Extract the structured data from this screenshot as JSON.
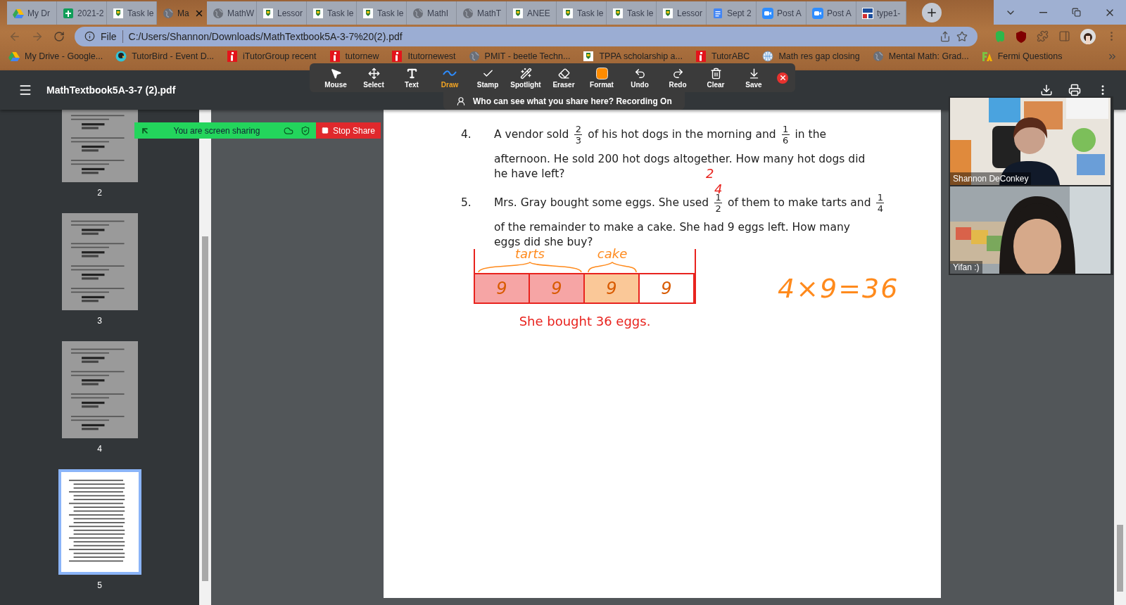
{
  "browser": {
    "tabs": [
      {
        "title": "My Dr",
        "kind": "drive",
        "selected": false
      },
      {
        "title": "2021-2",
        "kind": "sheets",
        "selected": false
      },
      {
        "title": "Task le",
        "kind": "crest",
        "selected": false
      },
      {
        "title": "Ma",
        "kind": "globe",
        "selected": true
      },
      {
        "title": "MathW",
        "kind": "globe",
        "selected": false
      },
      {
        "title": "Lessor",
        "kind": "crest",
        "selected": false
      },
      {
        "title": "Task le",
        "kind": "crest",
        "selected": false
      },
      {
        "title": "Task le",
        "kind": "crest",
        "selected": false
      },
      {
        "title": "MathI",
        "kind": "globe",
        "selected": false
      },
      {
        "title": "MathT",
        "kind": "globe",
        "selected": false
      },
      {
        "title": "ANEE",
        "kind": "crest",
        "selected": false
      },
      {
        "title": "Task le",
        "kind": "crest",
        "selected": false
      },
      {
        "title": "Task le",
        "kind": "crest",
        "selected": false
      },
      {
        "title": "Lessor",
        "kind": "crest",
        "selected": false
      },
      {
        "title": "Sept 2",
        "kind": "docs",
        "selected": false
      },
      {
        "title": "Post A",
        "kind": "zoom",
        "selected": false
      },
      {
        "title": "Post A",
        "kind": "zoom",
        "selected": false
      },
      {
        "title": "type1-",
        "kind": "mw",
        "selected": false
      }
    ],
    "address": {
      "scheme": "File",
      "url": "C:/Users/Shannon/Downloads/MathTextbook5A-3-7%20(2).pdf"
    },
    "bookmarks": [
      {
        "label": "My Drive - Google...",
        "kind": "drive"
      },
      {
        "label": "TutorBird - Event D...",
        "kind": "bird"
      },
      {
        "label": "iTutorGroup recent",
        "kind": "itutor"
      },
      {
        "label": "tutornew",
        "kind": "itutor"
      },
      {
        "label": "Itutornewest",
        "kind": "itutor"
      },
      {
        "label": "PMIT - beetle Techn...",
        "kind": "globe"
      },
      {
        "label": "TPPA scholarship a...",
        "kind": "crest"
      },
      {
        "label": "TutorABC",
        "kind": "itutor"
      },
      {
        "label": "Math res gap closing",
        "kind": "earth"
      },
      {
        "label": "Mental Math: Grad...",
        "kind": "globe"
      },
      {
        "label": "Fermi Questions",
        "kind": "fermi"
      }
    ]
  },
  "viewer": {
    "title": "MathTextbook5A-3-7 (2).pdf",
    "thumbnails": [
      {
        "page": "2",
        "selected": false
      },
      {
        "page": "3",
        "selected": false
      },
      {
        "page": "4",
        "selected": false
      },
      {
        "page": "5",
        "selected": true
      }
    ]
  },
  "problems": [
    {
      "number": "4.",
      "lines": [
        [
          {
            "kind": "text",
            "text": "A vendor sold "
          },
          {
            "kind": "fraction",
            "num": "2",
            "den": "3"
          },
          {
            "kind": "text",
            "text": " of his hot dogs in the morning and "
          },
          {
            "kind": "fraction",
            "num": "1",
            "den": "6"
          },
          {
            "kind": "text",
            "text": " in the"
          }
        ],
        [
          {
            "kind": "text",
            "text": "afternoon. He sold 200 hot dogs altogether. How many hot dogs did"
          }
        ],
        [
          {
            "kind": "text",
            "text": "he have left?"
          }
        ]
      ]
    },
    {
      "number": "5.",
      "lines": [
        [
          {
            "kind": "text",
            "text": "Mrs. Gray bought some eggs. She used "
          },
          {
            "kind": "fraction",
            "num": "1",
            "den": "2"
          },
          {
            "kind": "text",
            "text": " of them to make tarts and "
          },
          {
            "kind": "fraction",
            "num": "1",
            "den": "4"
          }
        ],
        [
          {
            "kind": "text",
            "text": "of the remainder to make a cake. She had 9 eggs left. How many"
          }
        ],
        [
          {
            "kind": "text",
            "text": "eggs did she buy?"
          }
        ]
      ]
    }
  ],
  "ink": {
    "note": [
      "2",
      "4"
    ],
    "groups": [
      {
        "label": "tarts",
        "cells": [
          {
            "value": "9",
            "color": "#f6a5a5"
          },
          {
            "value": "9",
            "color": "#f6a5a5"
          }
        ]
      },
      {
        "label": "cake",
        "cells": [
          {
            "value": "9",
            "color": "#fac898"
          }
        ]
      },
      {
        "cells": [
          {
            "value": "9",
            "color": "#ffffff"
          }
        ]
      }
    ],
    "answer": "She bought 36 eggs.",
    "equation": "4×9=36"
  },
  "annotation_toolbar": {
    "tools": [
      {
        "label": "Mouse",
        "kind": "mouse",
        "selected": false
      },
      {
        "label": "Select",
        "kind": "move",
        "selected": false
      },
      {
        "label": "Text",
        "kind": "text",
        "selected": false
      },
      {
        "label": "Draw",
        "kind": "draw",
        "selected": true
      },
      {
        "label": "Stamp",
        "kind": "stamp",
        "selected": false
      },
      {
        "label": "Spotlight",
        "kind": "spotlight",
        "selected": false
      },
      {
        "label": "Eraser",
        "kind": "eraser",
        "selected": false
      },
      {
        "label": "Format",
        "kind": "format",
        "selected": false
      },
      {
        "label": "Undo",
        "kind": "undo",
        "selected": false
      },
      {
        "label": "Redo",
        "kind": "redo",
        "selected": false
      },
      {
        "label": "Clear",
        "kind": "clear",
        "selected": false
      },
      {
        "label": "Save",
        "kind": "save",
        "selected": false
      }
    ],
    "notice": "Who can see what you share here? Recording On"
  },
  "share_bar": {
    "status": "You are screen sharing",
    "stop": "Stop Share"
  },
  "videos": [
    {
      "name": "Shannon DeConkey"
    },
    {
      "name": "Yifan :)"
    }
  ]
}
